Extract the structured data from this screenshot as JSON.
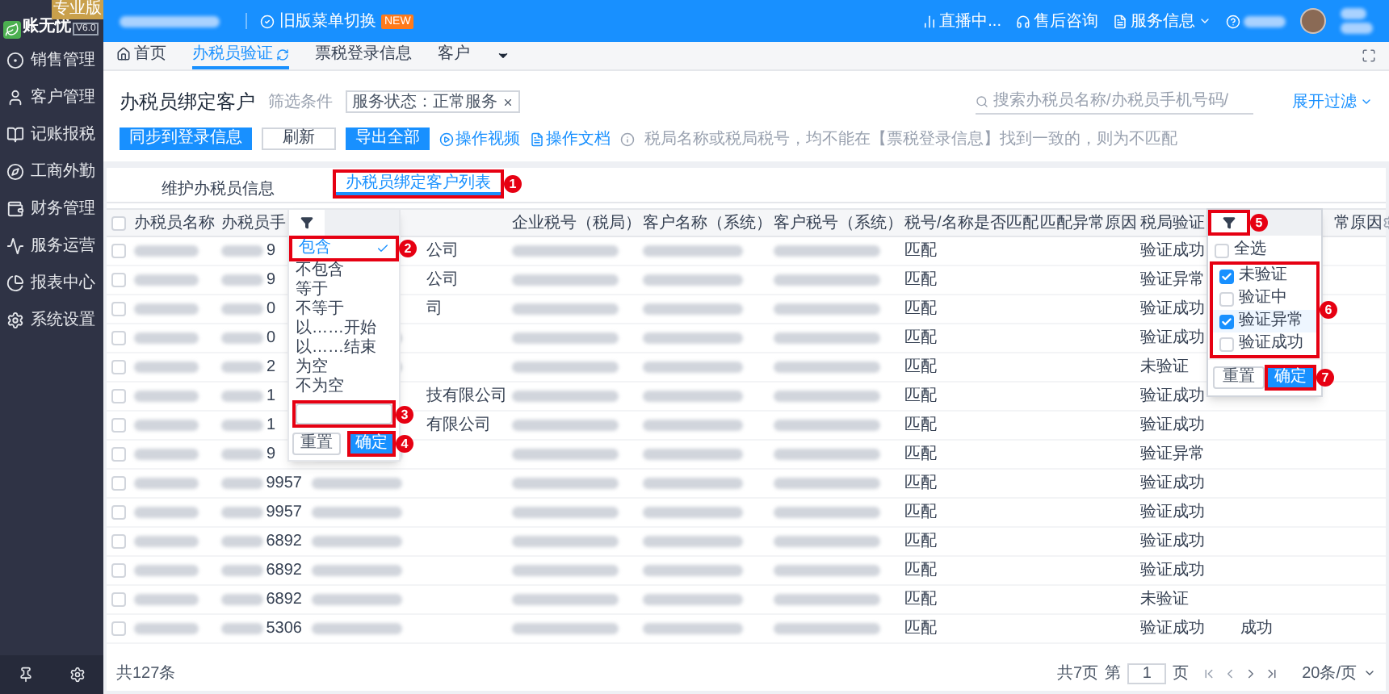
{
  "app": {
    "logo": "账无忧",
    "version": "V6.0",
    "edition": "专业版"
  },
  "sidebar": {
    "items": [
      {
        "label": "销售管理"
      },
      {
        "label": "客户管理"
      },
      {
        "label": "记账报税"
      },
      {
        "label": "工商外勤"
      },
      {
        "label": "财务管理"
      },
      {
        "label": "服务运营"
      },
      {
        "label": "报表中心"
      },
      {
        "label": "系统设置"
      }
    ]
  },
  "topbar": {
    "menu_switch": "旧版菜单切换",
    "new_badge": "NEW",
    "live": "直播中...",
    "support": "售后咨询",
    "service": "服务信息"
  },
  "tabs": [
    {
      "label": "首页",
      "selected": false
    },
    {
      "label": "办税员验证",
      "selected": true
    },
    {
      "label": "票税登录信息",
      "selected": false
    },
    {
      "label": "客户",
      "selected": false
    }
  ],
  "page": {
    "title": "办税员绑定客户",
    "filter_label": "筛选条件",
    "filter_chip": "服务状态：正常服务",
    "search": {
      "placeholder": "搜索办税员名称/办税员手机号码/"
    },
    "expand_filter": "展开过滤",
    "buttons": [
      {
        "label": "同步到登录信息",
        "kind": "primary"
      },
      {
        "label": "刷新",
        "kind": "default"
      },
      {
        "label": "导出全部",
        "kind": "primary"
      }
    ],
    "links": [
      {
        "label": "操作视频",
        "kind": "video"
      },
      {
        "label": "操作文档",
        "kind": "doc"
      }
    ],
    "note": "税局名称或税局税号，均不能在【票税登录信息】找到一致的，则为不匹配"
  },
  "inner_tabs": [
    {
      "label": "维护办税员信息",
      "selected": false
    },
    {
      "label": "办税员绑定客户列表",
      "selected": true,
      "annotation": "1"
    }
  ],
  "table": {
    "all_checked": false,
    "columns": {
      "name": "办税员名称",
      "phone": "办税员手",
      "tax": "企业税号（税局）",
      "custname": "客户名称（系统）",
      "custtax": "客户税号（系统）",
      "match": "税号/名称是否匹配",
      "matchreason": "匹配异常原因",
      "status": "税局验证",
      "reason": "常原因"
    },
    "rows": [
      {
        "checked": false,
        "phone": "9",
        "company": "公司",
        "match": "匹配",
        "status": "验证成功"
      },
      {
        "checked": false,
        "phone": "9",
        "company": "公司",
        "match": "匹配",
        "status": "验证异常"
      },
      {
        "checked": false,
        "phone": "0",
        "company": "司",
        "match": "匹配",
        "status": "验证成功"
      },
      {
        "checked": false,
        "phone": "0",
        "match": "匹配",
        "status": "验证成功"
      },
      {
        "checked": false,
        "phone": "2",
        "match": "匹配",
        "status": "未验证"
      },
      {
        "checked": false,
        "phone": "1",
        "company": "技有限公司",
        "match": "匹配",
        "status": "验证成功"
      },
      {
        "checked": false,
        "phone": "1",
        "company": "有限公司",
        "match": "匹配",
        "status": "验证成功"
      },
      {
        "checked": false,
        "phone": "9",
        "match": "匹配",
        "status": "验证异常"
      },
      {
        "checked": false,
        "phone": "9957",
        "match": "匹配",
        "status": "验证成功"
      },
      {
        "checked": false,
        "phone": "9957",
        "match": "匹配",
        "status": "验证成功"
      },
      {
        "checked": false,
        "phone": "6892",
        "match": "匹配",
        "status": "验证成功"
      },
      {
        "checked": false,
        "phone": "6892",
        "match": "匹配",
        "status": "验证成功"
      },
      {
        "checked": false,
        "phone": "6892",
        "match": "匹配",
        "status": "未验证"
      },
      {
        "checked": false,
        "phone": "5306",
        "match": "匹配",
        "status": "验证成功",
        "reason": "成功"
      }
    ]
  },
  "text_filter": {
    "options": [
      {
        "label": "包含",
        "selected": true,
        "annotation": "2"
      },
      {
        "label": "不包含",
        "selected": false
      },
      {
        "label": "等于",
        "selected": false
      },
      {
        "label": "不等于",
        "selected": false
      },
      {
        "label": "以……开始",
        "selected": false
      },
      {
        "label": "以……结束",
        "selected": false
      },
      {
        "label": "为空",
        "selected": false
      },
      {
        "label": "不为空",
        "selected": false
      }
    ],
    "input_annotation": "3",
    "reset": "重置",
    "confirm": "确定",
    "confirm_annotation": "4"
  },
  "status_filter": {
    "header_annotation": "5",
    "groups": [
      {
        "options": [
          {
            "label": "全选",
            "checked": false,
            "highlighted": false
          }
        ]
      },
      {
        "annotation": "6",
        "options": [
          {
            "label": "未验证",
            "checked": true,
            "highlighted": false
          },
          {
            "label": "验证中",
            "checked": false,
            "highlighted": false
          },
          {
            "label": "验证异常",
            "checked": true,
            "highlighted": true
          },
          {
            "label": "验证成功",
            "checked": false,
            "highlighted": false
          }
        ]
      }
    ],
    "reset": "重置",
    "confirm": "确定",
    "confirm_annotation": "7"
  },
  "footer": {
    "total": "共127条",
    "pages": "共7页",
    "page_prefix": "第",
    "page": "1",
    "page_suffix": "页",
    "page_size": "20条/页"
  }
}
